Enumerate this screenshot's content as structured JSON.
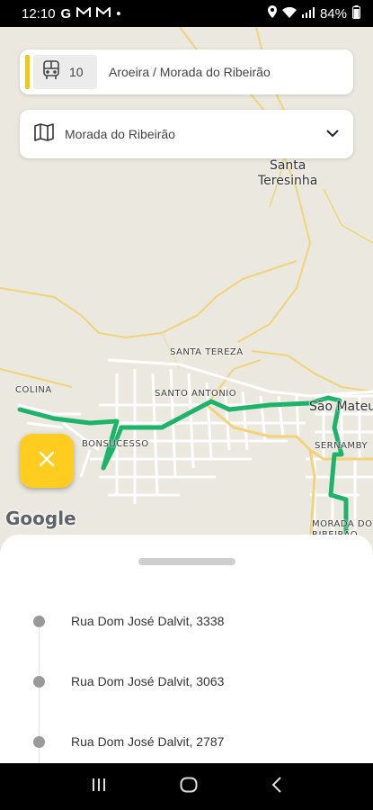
{
  "status_bar": {
    "time": "12:10",
    "notification_letters": "G",
    "battery": "84%"
  },
  "route_card": {
    "route_number": "10",
    "route_name": "Aroeira / Morada do Ribeirão",
    "accent_color": "#f5c518"
  },
  "destination": {
    "label": "Morada do Ribeirão"
  },
  "map": {
    "labels": {
      "santa_teresinha": "Santa\nTeresinha",
      "santa_tereza": "SANTA TEREZA",
      "santo_antonio": "SANTO ANTONIO",
      "colina": "COLINA",
      "bonsucesso": "BONSUCESSO",
      "sao_mateus": "São Mateu",
      "sernamby": "SERNAMBY",
      "morada": "MORADA DO\nRIBEIRÃO"
    },
    "attribution": "Google",
    "route_color": "#1db36b"
  },
  "stops": [
    {
      "name": "Rua Dom José Dalvit, 3338"
    },
    {
      "name": "Rua Dom José Dalvit, 3063"
    },
    {
      "name": "Rua Dom José Dalvit, 2787"
    }
  ],
  "fab": {
    "icon": "close-icon"
  }
}
